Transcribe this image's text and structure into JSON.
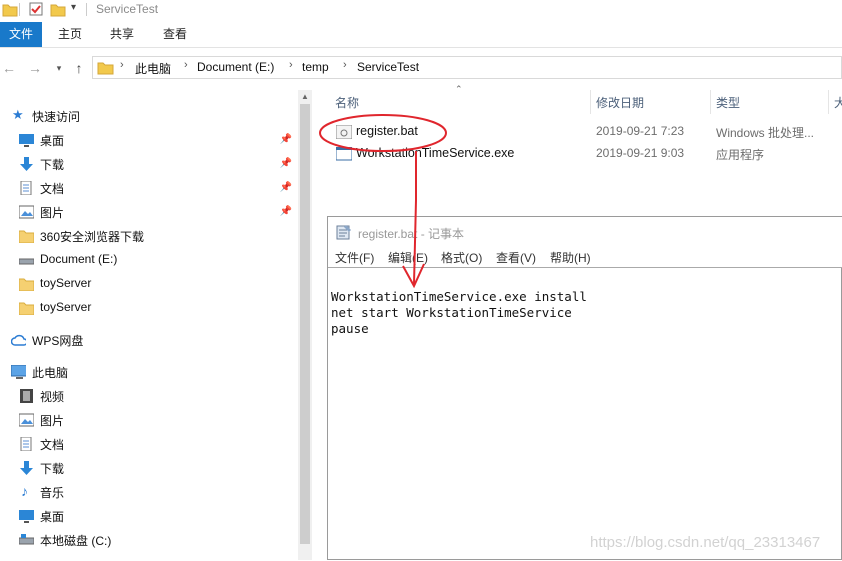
{
  "window": {
    "title": "ServiceTest"
  },
  "ribbon": {
    "tabs": [
      "文件",
      "主页",
      "共享",
      "查看"
    ]
  },
  "address": {
    "crumbs": [
      "此电脑",
      "Document (E:)",
      "temp",
      "ServiceTest"
    ]
  },
  "nav": {
    "quick_access": "快速访问",
    "items": [
      {
        "label": "桌面",
        "icon": "desktop-icon",
        "pinned": true
      },
      {
        "label": "下载",
        "icon": "download-icon",
        "pinned": true
      },
      {
        "label": "文档",
        "icon": "document-icon",
        "pinned": true
      },
      {
        "label": "图片",
        "icon": "picture-icon",
        "pinned": true
      },
      {
        "label": "360安全浏览器下载",
        "icon": "folder-icon"
      },
      {
        "label": "Document (E:)",
        "icon": "drive-icon"
      },
      {
        "label": "toyServer",
        "icon": "folder-icon"
      },
      {
        "label": "toyServer",
        "icon": "folder-icon"
      }
    ],
    "wps": "WPS网盘",
    "this_pc": "此电脑",
    "pc_items": [
      {
        "label": "视频",
        "icon": "video-icon"
      },
      {
        "label": "图片",
        "icon": "picture-icon"
      },
      {
        "label": "文档",
        "icon": "document-icon"
      },
      {
        "label": "下载",
        "icon": "download-icon"
      },
      {
        "label": "音乐",
        "icon": "music-icon"
      },
      {
        "label": "桌面",
        "icon": "desktop-icon"
      },
      {
        "label": "本地磁盘 (C:)",
        "icon": "drive-icon"
      }
    ]
  },
  "files": {
    "headers": {
      "name": "名称",
      "date": "修改日期",
      "type": "类型",
      "size": "大"
    },
    "rows": [
      {
        "name": "register.bat",
        "date": "2019-09-21 7:23",
        "type": "Windows 批处理..."
      },
      {
        "name": "WorkstationTimeService.exe",
        "date": "2019-09-21 9:03",
        "type": "应用程序"
      }
    ]
  },
  "notepad": {
    "title": "register.bat - 记事本",
    "menu": [
      "文件(F)",
      "编辑(E)",
      "格式(O)",
      "查看(V)",
      "帮助(H)"
    ],
    "content": "WorkstationTimeService.exe install\nnet start WorkstationTimeService\npause"
  },
  "watermark": "https://blog.csdn.net/qq_23313467",
  "colors": {
    "accent": "#1979ca",
    "annotation": "#e0262d"
  }
}
